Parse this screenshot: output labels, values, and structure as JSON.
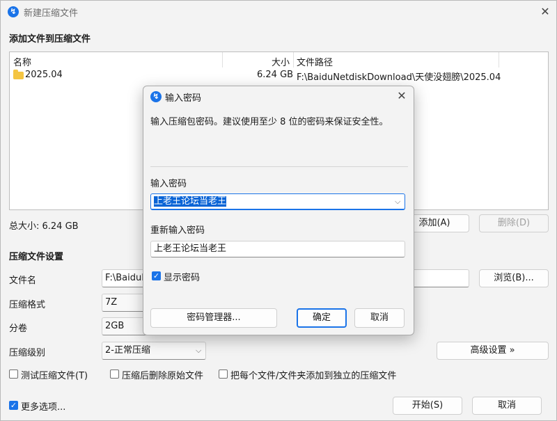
{
  "window": {
    "title": "新建压缩文件"
  },
  "add_section": {
    "heading": "添加文件到压缩文件",
    "columns": {
      "name": "名称",
      "size": "大小",
      "path": "文件路径"
    },
    "rows": [
      {
        "name": "2025.04",
        "size": "6.24 GB",
        "path": "F:\\BaiduNetdiskDownload\\天使没翅膀\\2025.04"
      }
    ],
    "total_size": "总大小: 6.24 GB",
    "add_button": "添加(A)",
    "delete_button": "删除(D)"
  },
  "settings": {
    "heading": "压缩文件设置",
    "filename_label": "文件名",
    "filename_value": "F:\\BaiduN",
    "browse_button": "浏览(B)...",
    "format_label": "压缩格式",
    "format_value": "7Z",
    "volume_label": "分卷",
    "volume_value": "2GB",
    "level_label": "压缩级别",
    "level_value": "2-正常压缩",
    "advanced_button": "高级设置 »",
    "opt_test": "测试压缩文件(T)",
    "opt_delete": "压缩后删除原始文件",
    "opt_separate": "把每个文件/文件夹添加到独立的压缩文件"
  },
  "footer": {
    "more_options": "更多选项...",
    "start_button": "开始(S)",
    "cancel_button": "取消"
  },
  "dialog": {
    "title": "输入密码",
    "description": "输入压缩包密码。建议使用至少 8 位的密码来保证安全性。",
    "password_label": "输入密码",
    "password_value": "上老王论坛当老王",
    "confirm_label": "重新输入密码",
    "confirm_value": "上老王论坛当老王",
    "show_password": "显示密码",
    "manager_button": "密码管理器...",
    "ok_button": "确定",
    "cancel_button": "取消"
  },
  "colors": {
    "accent": "#1a73e8",
    "selection": "#0a64d6",
    "folder": "#f4c542"
  }
}
